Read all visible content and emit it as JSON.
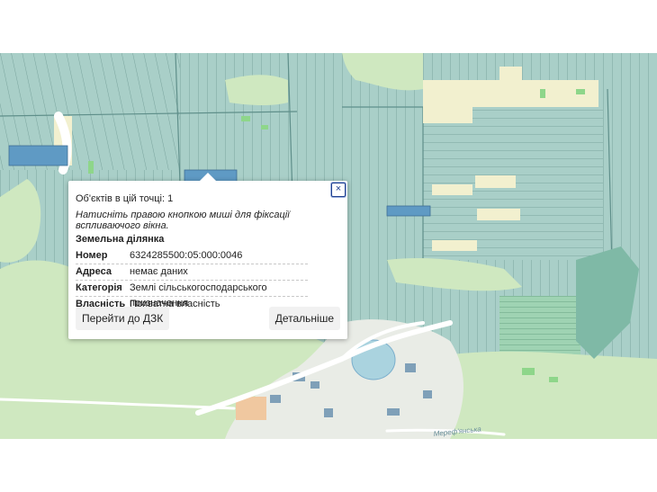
{
  "popup": {
    "count_text": "Об'єктів в цій точці: 1",
    "hint_text": "Натисніть правою кнопкою миші для фіксації вспливаючого вікна.",
    "section_title": "Земельна ділянка",
    "close_symbol": "×",
    "properties": [
      {
        "key": "Номер",
        "value": "6324285500:05:000:0046"
      },
      {
        "key": "Адреса",
        "value": "немає даних"
      },
      {
        "key": "Категорія",
        "value": "Землі сільськогосподарського призначення"
      },
      {
        "key": "Власність",
        "value": "Приватна власність"
      }
    ],
    "goto_button": "Перейти до ДЗК",
    "details_button": "Детальніше"
  },
  "map": {
    "road_label": "Мереф'янська",
    "colors": {
      "parcel": "#a9cfc8",
      "parcel_edge": "#5f8f8a",
      "forest": "#cfe8c0",
      "road": "#ffffff",
      "sand": "#f2f0cf",
      "selected_parcel": "#5f9ac4",
      "water": "#aad3df"
    }
  }
}
